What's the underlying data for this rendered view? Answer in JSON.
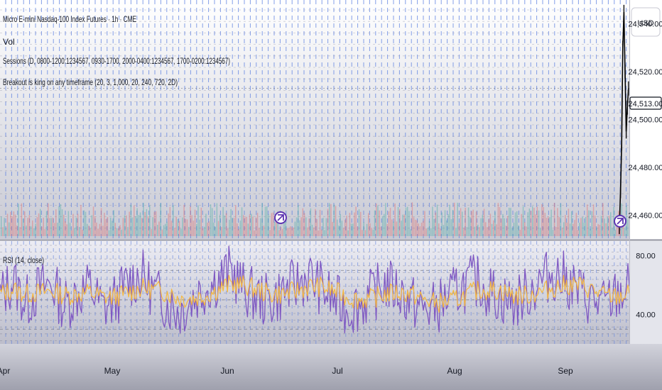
{
  "legend": {
    "symbol_line": "Micro E-mini Nasdaq-100 Index Futures · 1h · CME",
    "vol": "Vol",
    "sessions": "Sessions (D, 0800-1200:1234567, 0930-1700, 2000-0400:1234567, 1700-0200:1234567)",
    "breakout": "Breakout is king on any timeframe (20, 3, 1,000, 20, 240, 720, 2D)",
    "rsi": "RSI (14, close)"
  },
  "price_axis": {
    "currency": "USD",
    "ticks": [
      "24,540.00",
      "24,520.00",
      "24,500.00",
      "24,480.00",
      "24,460.00"
    ],
    "current_price": "24,513.00"
  },
  "rsi_axis": {
    "ticks": [
      "80.00",
      "40.00"
    ]
  },
  "time_axis": {
    "labels": [
      "Apr",
      "May",
      "Jun",
      "Jul",
      "Aug",
      "Sep"
    ]
  },
  "colors": {
    "background": "#ffffff",
    "grid": "#5b7fe0",
    "candle": "#000000",
    "rsi_line": "#7e57c2",
    "rsi_ma": "#f5b940",
    "volume_up": "#26a69a",
    "volume_down": "#ef5350",
    "marker": "#5e35b1"
  },
  "chart_data": [
    {
      "type": "line",
      "title": "Micro E-mini Nasdaq-100 Index Futures · 1h · CME",
      "series": [
        {
          "name": "price",
          "x": [
            1,
            2,
            3,
            4,
            5,
            6,
            7,
            8,
            9
          ],
          "values": [
            24455,
            24470,
            24490,
            24530,
            24545,
            24520,
            24495,
            24505,
            24513
          ]
        }
      ],
      "ylim": [
        24450,
        24550
      ],
      "yticks": [
        24540,
        24520,
        24500,
        24480,
        24460
      ],
      "last_price": 24513
    },
    {
      "type": "line",
      "title": "RSI (14, close)",
      "categories": [
        "Apr",
        "May",
        "Jun",
        "Jul",
        "Aug",
        "Sep"
      ],
      "series": [
        {
          "name": "RSI",
          "values": [
            52,
            63,
            48,
            57,
            61,
            46,
            54,
            59,
            44,
            50,
            62,
            67,
            55,
            48,
            42,
            51,
            58,
            64,
            70,
            57,
            52,
            49,
            55,
            60,
            66,
            58,
            50,
            44,
            47,
            53,
            61,
            56,
            49,
            43,
            45,
            52,
            59,
            63,
            57,
            51,
            48,
            54,
            62,
            68,
            64,
            56,
            50,
            46,
            53,
            58
          ]
        },
        {
          "name": "RSI MA",
          "values": [
            54,
            57,
            54,
            55,
            56,
            53,
            54,
            55,
            52,
            52,
            55,
            58,
            57,
            55,
            51,
            51,
            53,
            57,
            61,
            60,
            57,
            54,
            54,
            56,
            59,
            59,
            56,
            52,
            50,
            51,
            54,
            55,
            54,
            50,
            48,
            49,
            52,
            56,
            57,
            56,
            53,
            53,
            55,
            58,
            60,
            60,
            57,
            53,
            52,
            54
          ]
        }
      ],
      "ylim": [
        20,
        90
      ],
      "yticks": [
        80,
        40
      ],
      "bands": [
        30,
        50,
        70
      ]
    }
  ]
}
